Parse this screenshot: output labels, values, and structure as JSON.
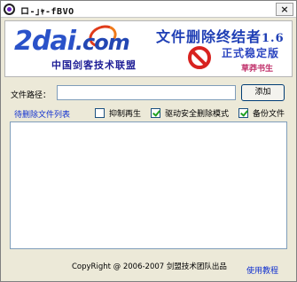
{
  "window": {
    "title": "ロ-｣ｬ-fBVO",
    "close_glyph": "×"
  },
  "banner": {
    "logo_main": "2dai",
    "logo_com": ".com",
    "logo_sub": "中国剑客技术联盟",
    "product_title": "文件删除终结者",
    "product_version": "1.6",
    "edition": "正式稳定版",
    "author": "草莽书生"
  },
  "path": {
    "label": "文件路径：",
    "value": "",
    "placeholder": "",
    "add_button": "添加"
  },
  "options": {
    "list_title": "待删除文件列表",
    "items": [
      {
        "label": "抑制再生",
        "checked": false
      },
      {
        "label": "驱动安全删除模式",
        "checked": true
      },
      {
        "label": "备份文件",
        "checked": true
      }
    ]
  },
  "file_list": {
    "items": []
  },
  "footer": {
    "copyright": "CopyRight @ 2006-2007 剑盟技术团队出品",
    "help_link": "使用教程"
  },
  "colors": {
    "window_bg": "#ece9d8",
    "link_blue": "#1030d0",
    "logo_blue": "#2a52c9",
    "accent_red": "#d8221f"
  }
}
